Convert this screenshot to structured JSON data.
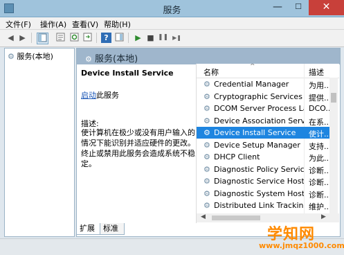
{
  "window": {
    "title": "服务",
    "min_glyph": "—",
    "max_glyph": "☐",
    "close_glyph": "✕"
  },
  "menu": [
    {
      "label": "文件(F)"
    },
    {
      "label": "操作(A)"
    },
    {
      "label": "查看(V)"
    },
    {
      "label": "帮助(H)"
    }
  ],
  "toolbar": {
    "icons": [
      "back-icon",
      "forward-icon",
      "show-tree-icon",
      "properties-icon",
      "refresh-icon",
      "export-icon",
      "help-icon",
      "show-console-icon",
      "start-icon",
      "stop-icon",
      "pause-icon",
      "restart-icon"
    ],
    "glyphs": {
      "back": "◀",
      "forward": "▶",
      "start": "▶",
      "stop": "■",
      "pause": "❚❚",
      "restart": "▶❚",
      "help": "?"
    }
  },
  "tree": {
    "item_label": "服务(本地)"
  },
  "panel": {
    "header": "服务(本地)",
    "selected_service": "Device Install Service",
    "start_link": "启动",
    "start_suffix": "此服务",
    "description_label": "描述:",
    "description_text": "使计算机在极少或没有用户输入的情况下能识别并适应硬件的更改。终止或禁用此服务会造成系统不稳定。"
  },
  "list": {
    "col_name": "名称",
    "col_desc": "描述",
    "sort_glyph": "^",
    "rows": [
      {
        "name": "Credential Manager",
        "desc": "为用..."
      },
      {
        "name": "Cryptographic Services",
        "desc": "提供..."
      },
      {
        "name": "DCOM Server Process La...",
        "desc": "DCO..."
      },
      {
        "name": "Device Association Service",
        "desc": "在系..."
      },
      {
        "name": "Device Install Service",
        "desc": "使计...",
        "selected": true
      },
      {
        "name": "Device Setup Manager",
        "desc": "支持..."
      },
      {
        "name": "DHCP Client",
        "desc": "为此..."
      },
      {
        "name": "Diagnostic Policy Service",
        "desc": "诊断..."
      },
      {
        "name": "Diagnostic Service Host",
        "desc": "诊断..."
      },
      {
        "name": "Diagnostic System Host",
        "desc": "诊断..."
      },
      {
        "name": "Distributed Link Tracking...",
        "desc": "维护..."
      }
    ]
  },
  "tabs": [
    {
      "label": "扩展"
    },
    {
      "label": "标准"
    }
  ],
  "watermark": {
    "title": "学知网",
    "url": "www.jmqz1000.com"
  }
}
